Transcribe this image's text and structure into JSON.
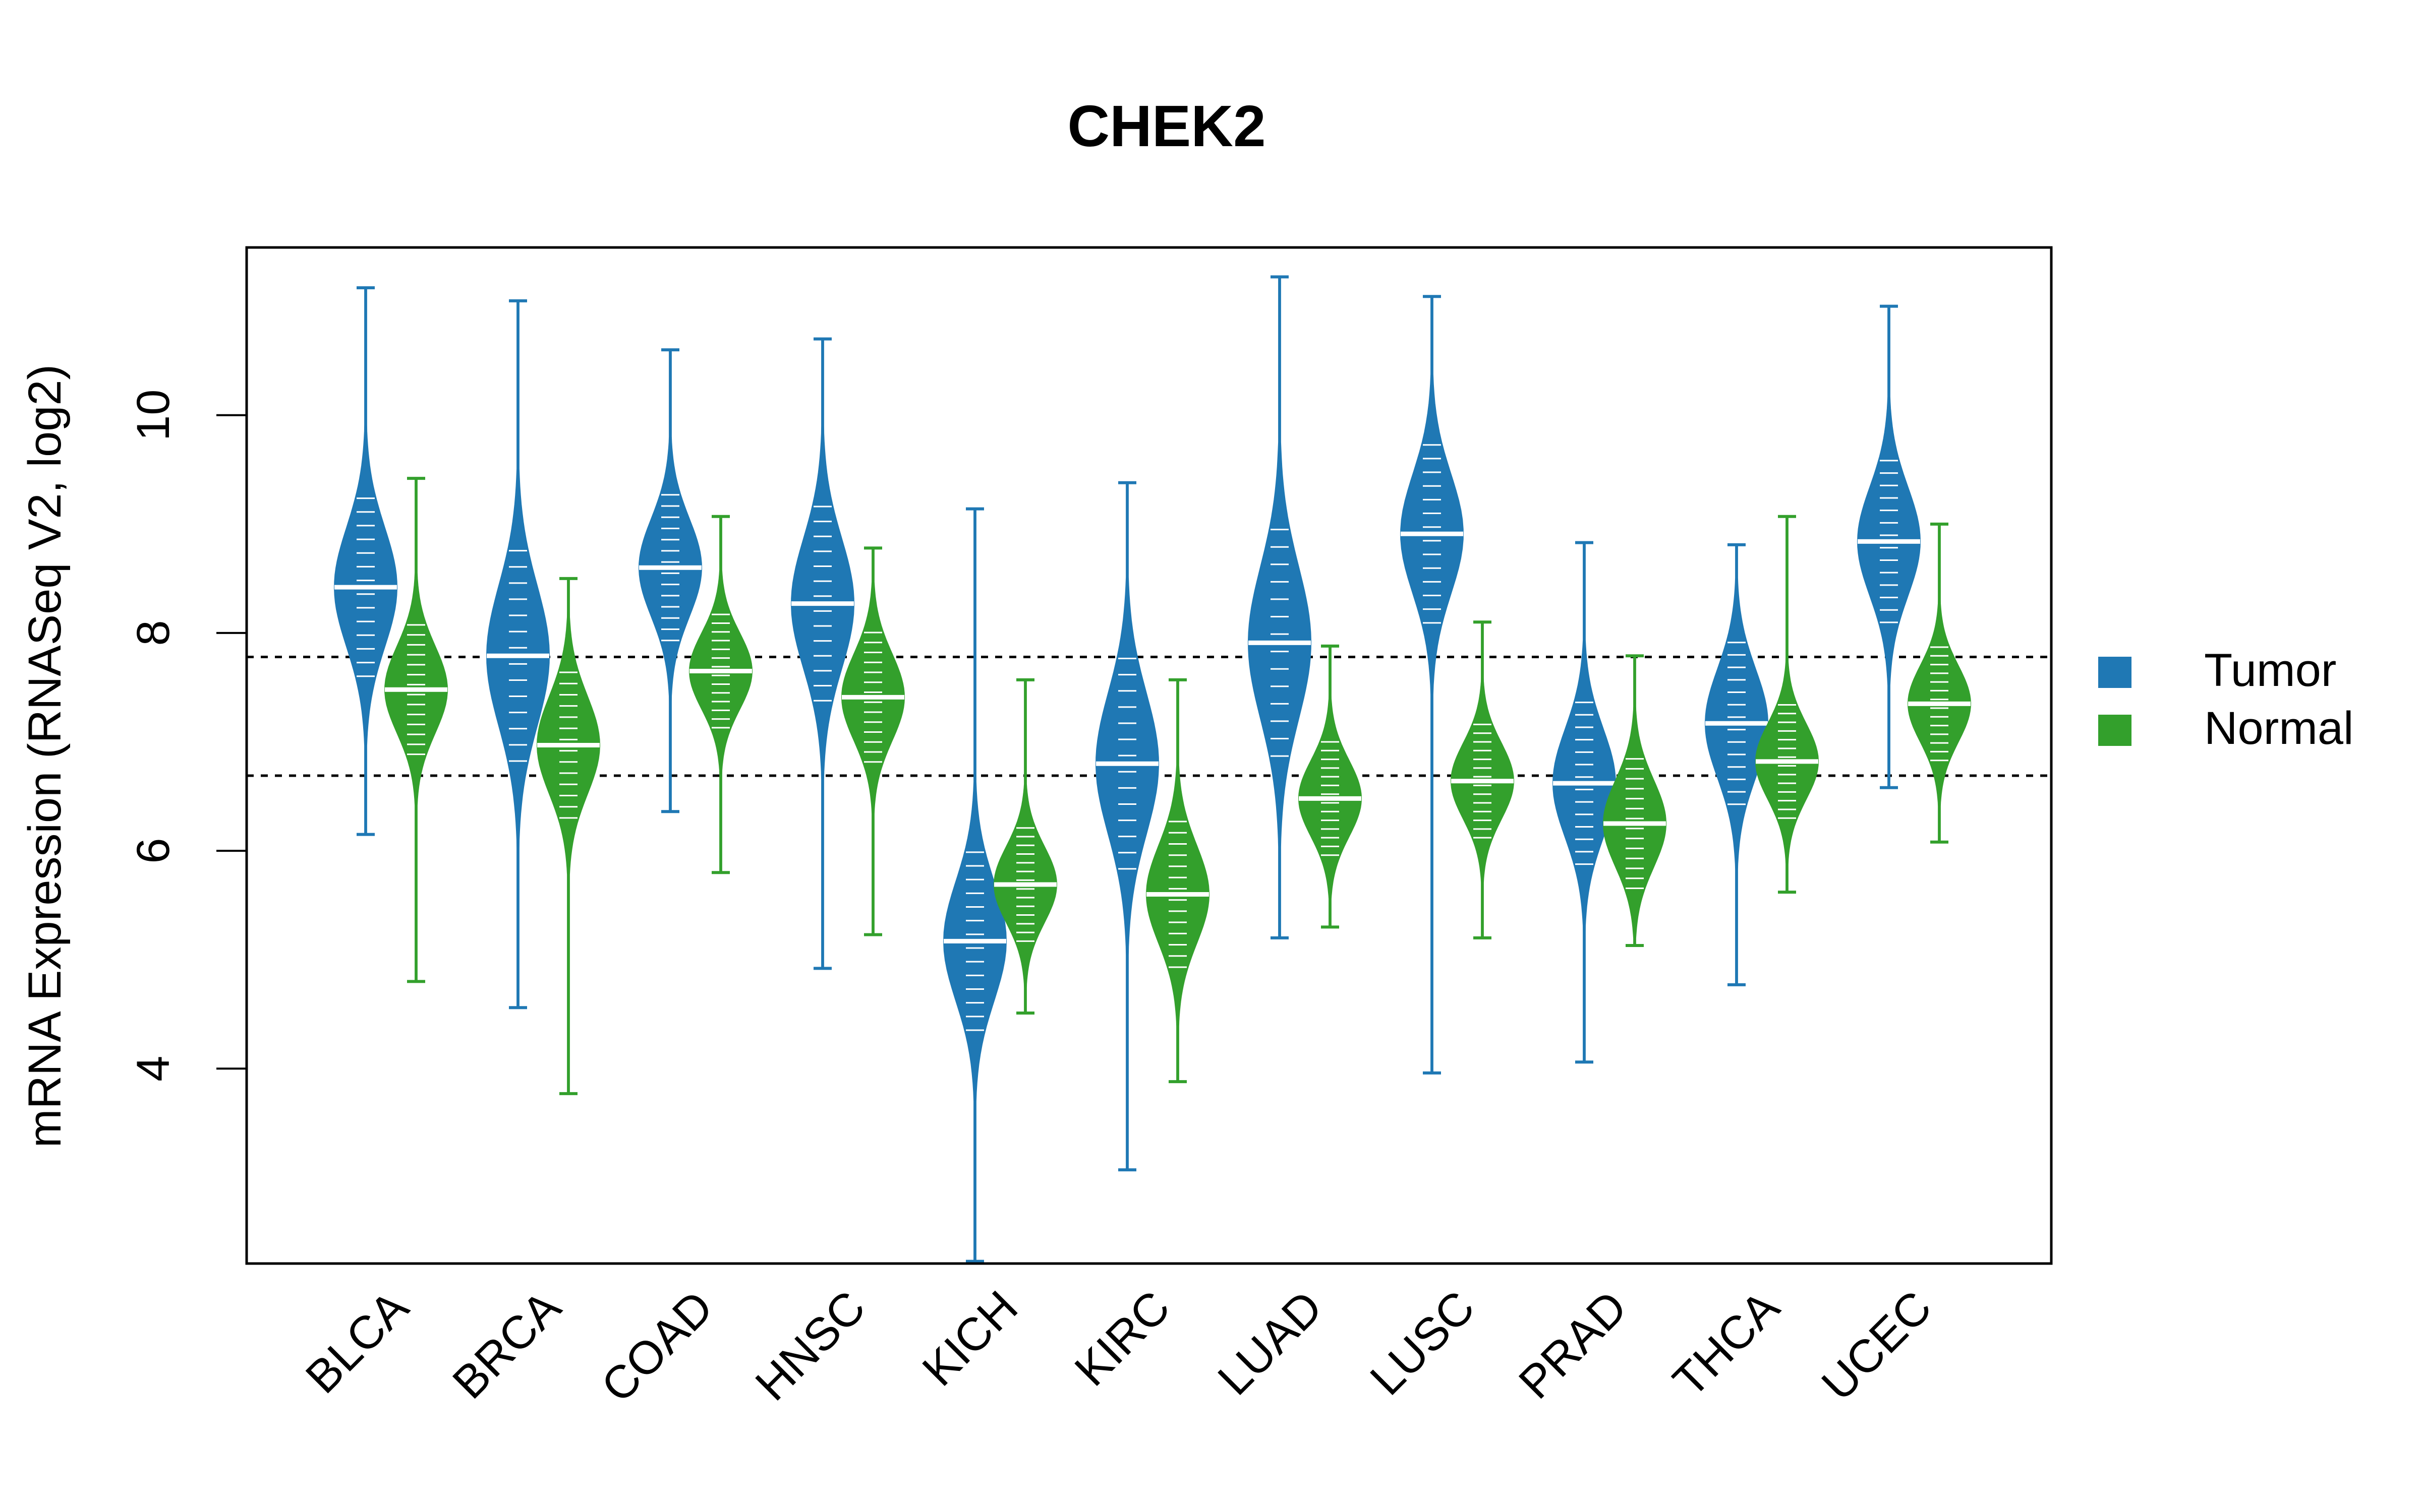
{
  "chart_data": {
    "type": "beanplot",
    "title": "CHEK2",
    "xlabel": "",
    "ylabel": "mRNA Expression (RNASeq V2, log2)",
    "ylim": [
      2.21,
      11.54
    ],
    "yticks": [
      4,
      6,
      8,
      10
    ],
    "ytick_labels": [
      "4",
      "6",
      "8",
      "10"
    ],
    "grid": false,
    "reference_lines": [
      7.78,
      6.69
    ],
    "categories": [
      "BLCA",
      "BRCA",
      "COAD",
      "HNSC",
      "KICH",
      "KIRC",
      "LUAD",
      "LUSC",
      "PRAD",
      "THCA",
      "UCEC"
    ],
    "legend": {
      "position": "right",
      "entries": [
        {
          "label": "Tumor",
          "color": "#1F78B4"
        },
        {
          "label": "Normal",
          "color": "#33A02C"
        }
      ]
    },
    "series": [
      {
        "name": "Tumor",
        "color": "#1F78B4",
        "median": [
          8.42,
          7.79,
          8.6,
          8.27,
          5.17,
          6.8,
          7.91,
          8.91,
          6.62,
          7.17,
          8.84
        ],
        "min": [
          6.15,
          4.56,
          6.36,
          4.92,
          2.23,
          3.07,
          5.2,
          3.96,
          4.06,
          4.77,
          6.58
        ],
        "max": [
          11.17,
          11.05,
          10.6,
          10.7,
          9.14,
          9.38,
          11.27,
          11.09,
          8.83,
          8.81,
          11.0
        ],
        "spread": [
          0.55,
          0.65,
          0.45,
          0.6,
          0.55,
          0.65,
          0.7,
          0.55,
          0.5,
          0.5,
          0.5
        ]
      },
      {
        "name": "Normal",
        "color": "#33A02C",
        "median": [
          7.48,
          6.97,
          7.65,
          7.41,
          5.69,
          5.6,
          6.48,
          6.64,
          6.25,
          6.82,
          7.35
        ],
        "min": [
          4.8,
          3.77,
          5.8,
          5.23,
          4.51,
          3.88,
          5.3,
          5.2,
          5.13,
          5.62,
          6.08
        ],
        "max": [
          9.42,
          8.5,
          9.07,
          8.78,
          7.57,
          7.57,
          7.88,
          8.1,
          7.79,
          9.07,
          9.0
        ],
        "spread": [
          0.4,
          0.45,
          0.35,
          0.4,
          0.35,
          0.45,
          0.35,
          0.35,
          0.4,
          0.35,
          0.35
        ]
      }
    ]
  }
}
